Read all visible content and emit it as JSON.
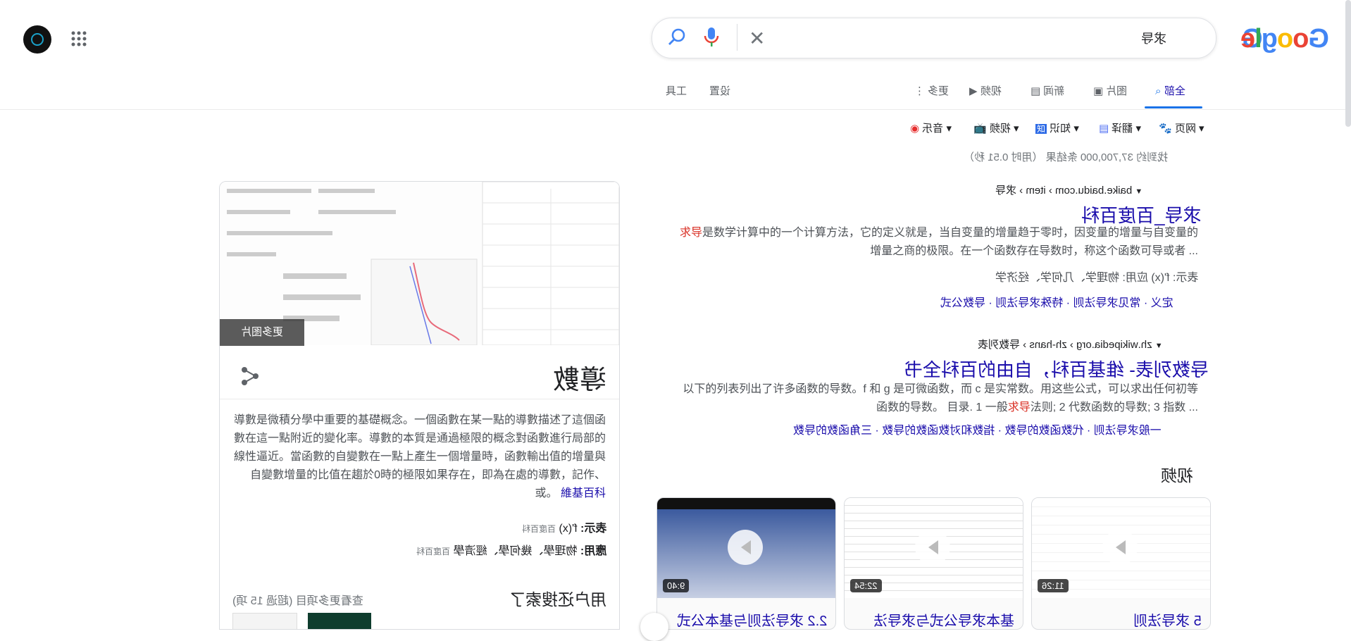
{
  "header": {
    "logo": "Google",
    "query": "求导",
    "brand_colors": {
      "blue": "#4285f4",
      "red": "#ea4335",
      "yellow": "#fbbc05",
      "green": "#34a853"
    }
  },
  "tabs": [
    {
      "label": "全部",
      "icon": "search-icon",
      "active": true
    },
    {
      "label": "图片",
      "icon": "image-icon"
    },
    {
      "label": "新闻",
      "icon": "news-icon"
    },
    {
      "label": "视频",
      "icon": "video-icon"
    },
    {
      "label": "更多",
      "icon": "more-vert-icon"
    },
    {
      "label": "设置"
    },
    {
      "label": "工具"
    }
  ],
  "filters": [
    {
      "label": "网页",
      "icon": "paw-icon"
    },
    {
      "label": "翻译",
      "icon": "translate-icon"
    },
    {
      "label": "知识",
      "icon": "zhi-icon"
    },
    {
      "label": "视频",
      "icon": "tv-icon"
    },
    {
      "label": "音乐",
      "icon": "music-icon"
    }
  ],
  "stats": "找到约 37,700,000 条结果 （用时 0.51 秒）",
  "results": [
    {
      "cite": "baike.baidu.com › item › 求导",
      "title": "求导_百度百科",
      "snippet_hl": "求导",
      "snippet_rest": "是数学计算中的一个计算方法，它的定义就是，当自变量的增量趋于零时，因变量的增量与自变量的增量之商的极限。在一个函数存在导数时，称这个函数可导或者 ...",
      "facts": "表示: f'(x)  应用: 物理学、几何学、经济学",
      "sitelinks": "定义 · 常见求导法则 · 特殊求导法则 · 导数公式"
    },
    {
      "cite": "zh.wikipedia.org › zh-hans › 导数列表",
      "title": "导数列表- 维基百科，自由的百科全书",
      "snippet_a": "以下的列表列出了许多函数的导数。f 和 g 是可微函数，而 c 是实常数。用这些公式，可以求出任何初等函数的导数。 目录. 1 一般",
      "snippet_hl": "求导",
      "snippet_b": "法则; 2 代数函数的导数; 3 指数 ...",
      "sitelinks": "一般求导法则 · 代数函数的导数 · 指数和对数函数的导数 · 三角函数的导数"
    }
  ],
  "videos_heading": "视频",
  "videos": [
    {
      "duration": "11:26",
      "title": "5 求导法则"
    },
    {
      "duration": "22:54",
      "title": "基本求导公式与求导法"
    },
    {
      "duration": "9:40",
      "title": "2.2 求导法则与基本公式"
    }
  ],
  "panel": {
    "more_images": "更多图片",
    "title": "導數",
    "description": "導數是微積分學中重要的基礎概念。一個函數在某一點的導數描述了這個函數在這一點附近的變化率。導數的本質是通過極限的概念對函數進行局部的線性逼近。當函數的自變數在一點上產生一個增量時，函數輸出值的增量與自變數增量的比值在趨於0時的極限如果存在，即為在處的導數，記作、或。",
    "desc_source": "維基百科",
    "fact1_label": "表示:",
    "fact1_value": "f'(x)",
    "fact1_src": "百度百科",
    "fact2_label": "應用:",
    "fact2_value": "物理學、幾何學、經濟學",
    "fact2_src": "百度百科",
    "also_heading": "用户还搜索了",
    "also_more": "查看更多項目 (超過 15 項)"
  }
}
